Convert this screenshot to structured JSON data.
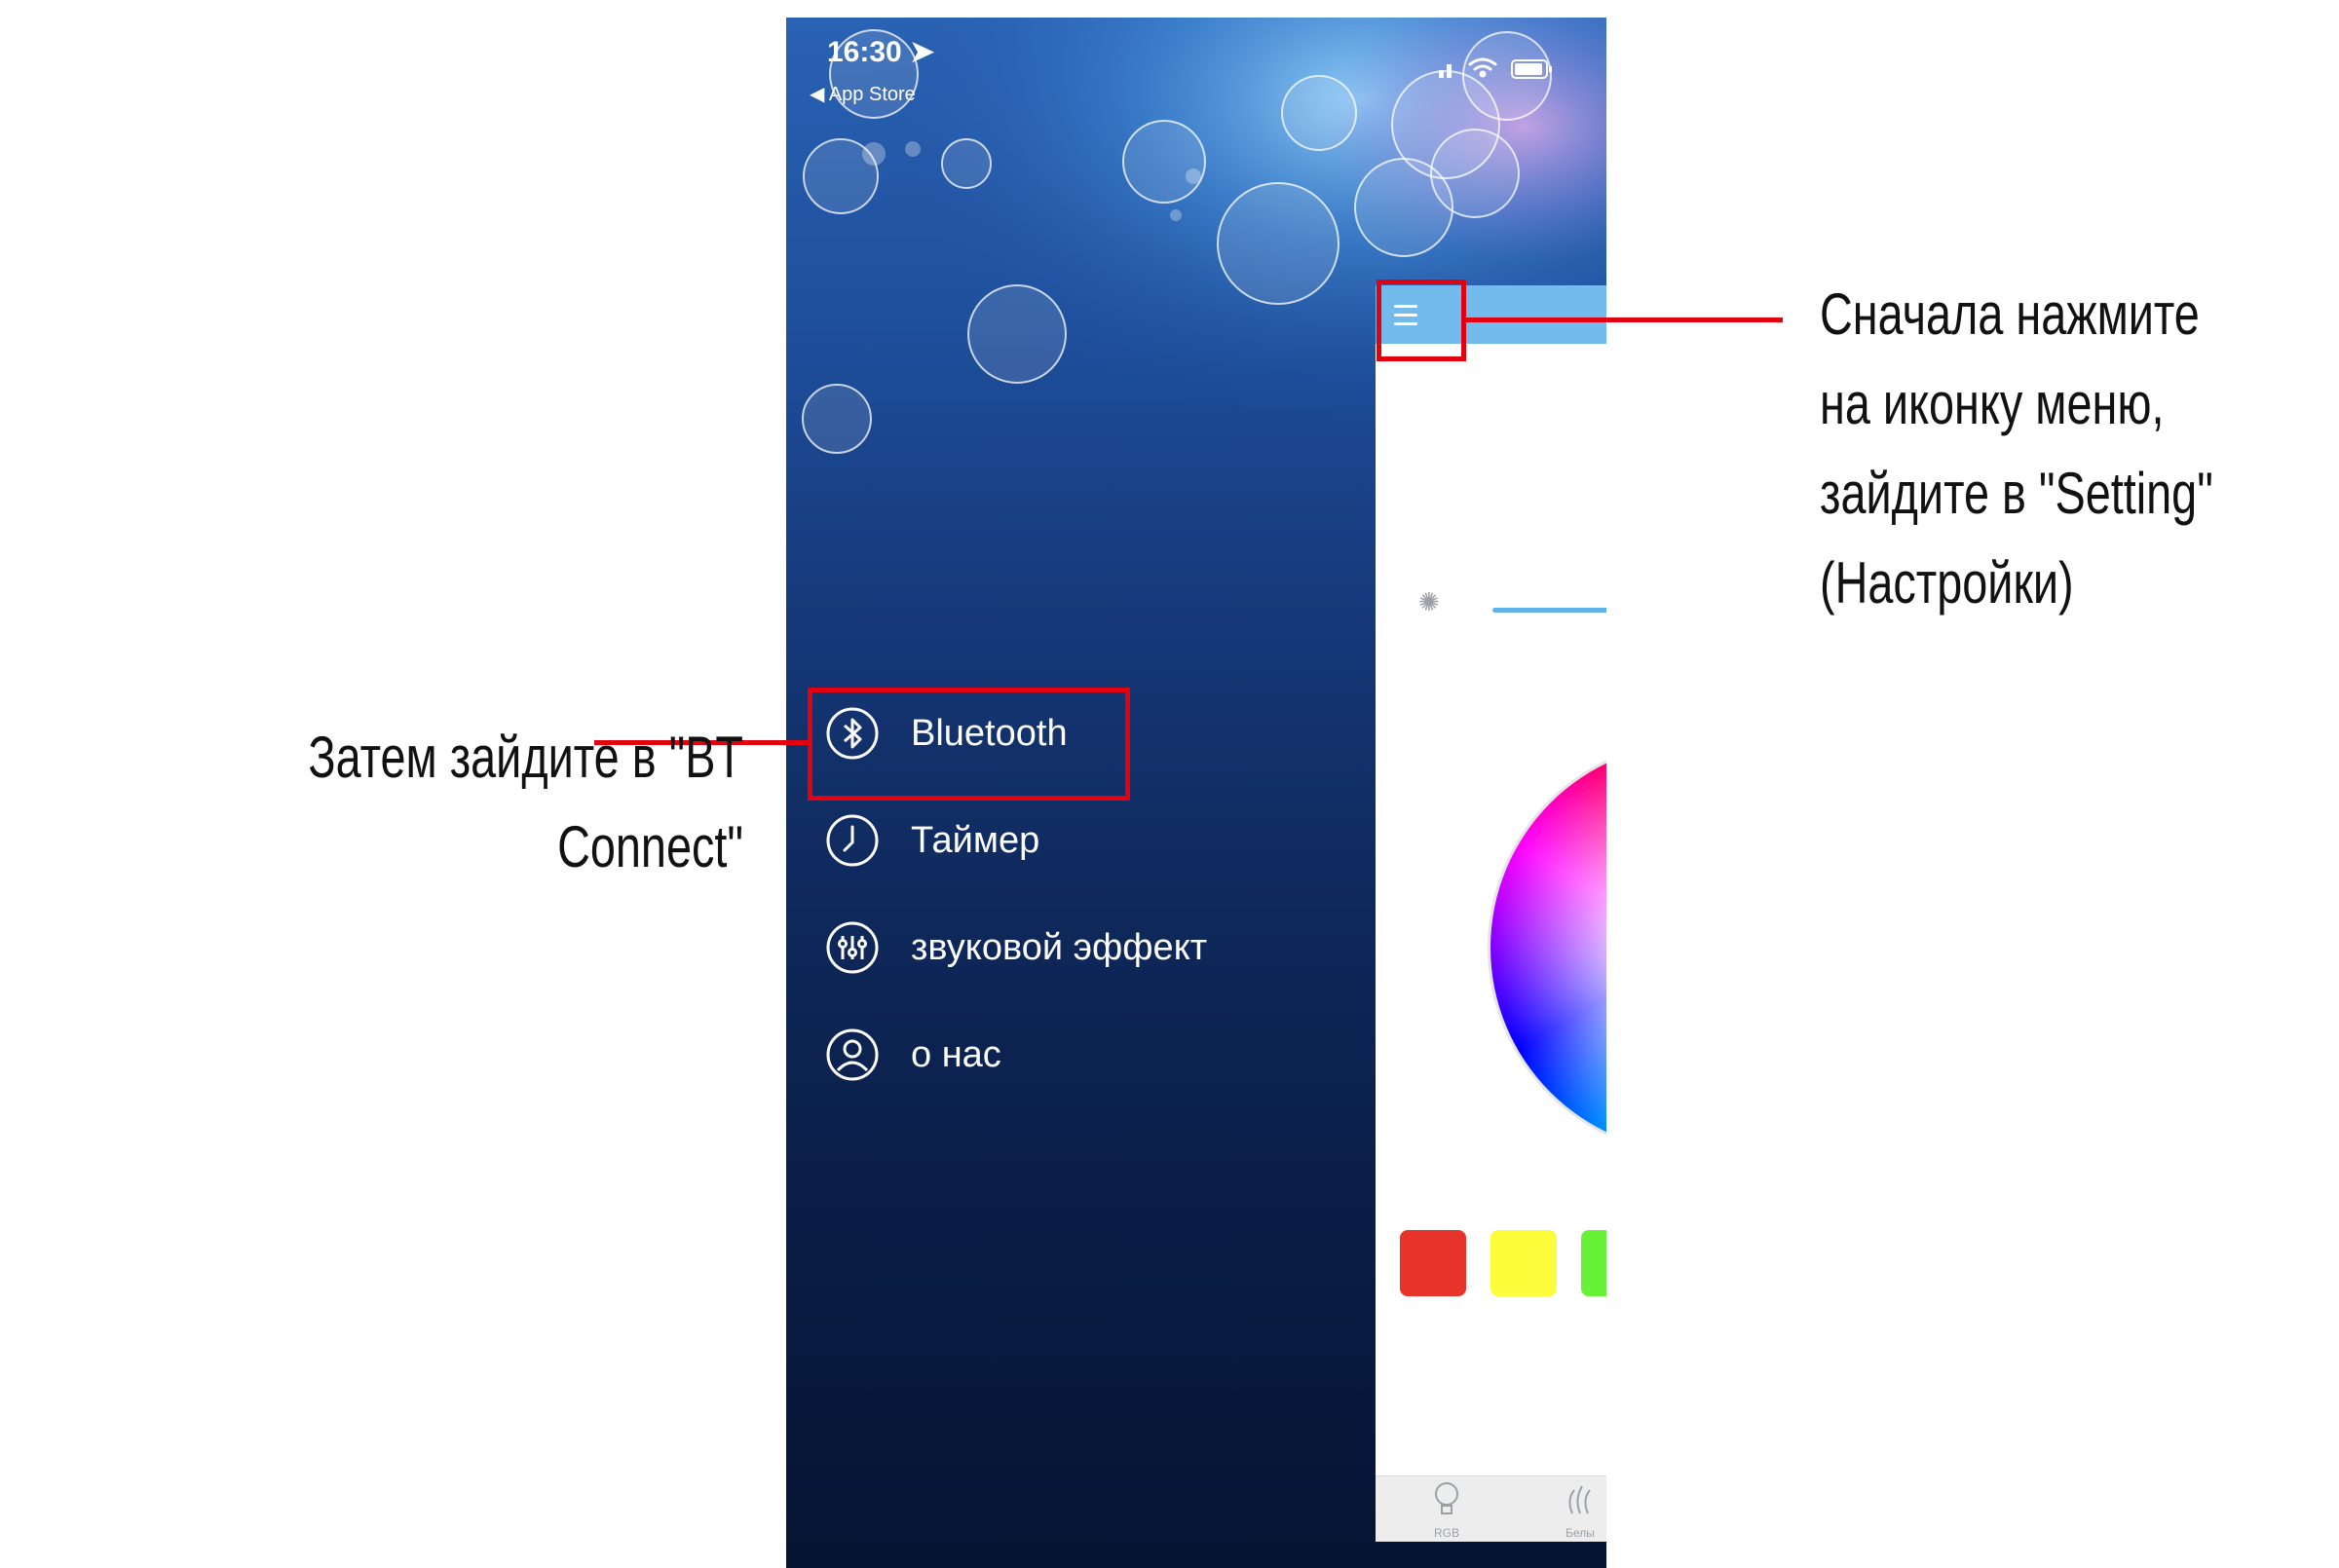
{
  "status_bar": {
    "time": "16:30 ➤",
    "back_label": "◀ App Store"
  },
  "colors": {
    "accent_red": "#e3000f",
    "header_blue": "#73bbec",
    "slider_blue": "#5db2ea"
  },
  "nav": {
    "items": [
      {
        "label": "Bluetooth",
        "icon": "bluetooth-icon"
      },
      {
        "label": "Таймер",
        "icon": "clock-icon"
      },
      {
        "label": "звуковой эффект",
        "icon": "equalizer-icon"
      },
      {
        "label": "о нас",
        "icon": "user-icon"
      }
    ]
  },
  "main_panel": {
    "header_icon": "hamburger-menu-icon",
    "brightness_icon": "sun-icon",
    "swatches": [
      "#e8332a",
      "#fdfd3c",
      "#67f238"
    ],
    "tabs": [
      {
        "label": "RGB",
        "icon": "bulb-icon"
      },
      {
        "label": "Белы",
        "icon": "flame-icon"
      }
    ]
  },
  "annotations": {
    "menu_note": [
      "Сначала нажмите",
      "на иконку меню,",
      "зайдите в \"Setting\"",
      "(Настройки)"
    ],
    "bt_note": [
      "Затем зайдите в \"BT",
      "Connect\""
    ]
  }
}
